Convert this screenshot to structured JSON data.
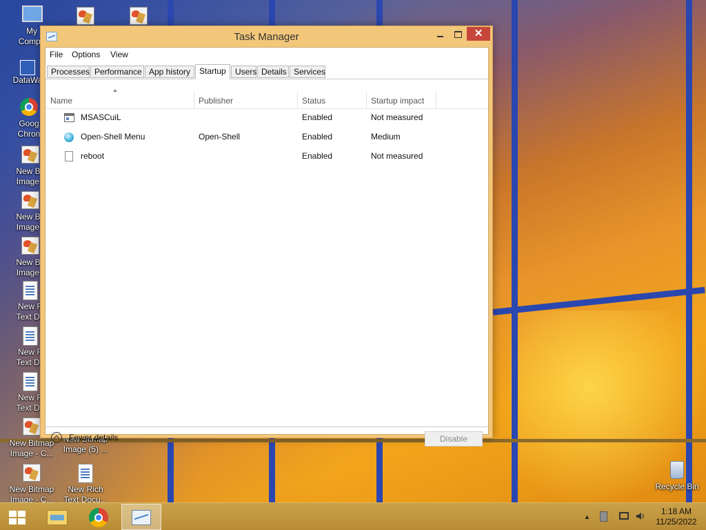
{
  "desktop": {
    "icons": [
      {
        "label_line1": "My",
        "label_line2": "Compu"
      },
      {
        "label_line1": "DataWa",
        "label_line2": ""
      },
      {
        "label_line1": "Goog",
        "label_line2": "Chron"
      },
      {
        "label_line1": "New Bit",
        "label_line2": "Image ("
      },
      {
        "label_line1": "New Bit",
        "label_line2": "Image ("
      },
      {
        "label_line1": "New Bit",
        "label_line2": "Image ("
      },
      {
        "label_line1": "New R",
        "label_line2": "Text Do"
      },
      {
        "label_line1": "New R",
        "label_line2": "Text Do"
      },
      {
        "label_line1": "New R",
        "label_line2": "Text Do"
      },
      {
        "label_line1": "New Bitmap",
        "label_line2": "Image - C..."
      },
      {
        "label_line1": "New Bitmap",
        "label_line2": "Image (5) ..."
      },
      {
        "label_line1": "New Bitmap",
        "label_line2": "Image - C..."
      },
      {
        "label_line1": "New Rich",
        "label_line2": "Text Docu..."
      },
      {
        "label_line1": "Recycle Bin",
        "label_line2": ""
      }
    ]
  },
  "window": {
    "title": "Task Manager",
    "close_glyph": "✕",
    "menu": [
      "File",
      "Options",
      "View"
    ],
    "tabs": [
      "Processes",
      "Performance",
      "App history",
      "Startup",
      "Users",
      "Details",
      "Services"
    ],
    "active_tab": "Startup",
    "columns": [
      "Name",
      "Publisher",
      "Status",
      "Startup impact"
    ],
    "rows": [
      {
        "name": "MSASCuiL",
        "publisher": "",
        "status": "Enabled",
        "impact": "Not measured",
        "icon": "app-window-icon"
      },
      {
        "name": "Open-Shell Menu",
        "publisher": "Open-Shell",
        "status": "Enabled",
        "impact": "Medium",
        "icon": "shell-icon"
      },
      {
        "name": "reboot",
        "publisher": "",
        "status": "Enabled",
        "impact": "Not measured",
        "icon": "file-icon"
      }
    ],
    "fewer_details": "Fewer details",
    "disable_button": "Disable"
  },
  "taskbar": {
    "tray_arrow": "▲",
    "clock_time": "1:18 AM",
    "clock_date": "11/25/2022"
  }
}
